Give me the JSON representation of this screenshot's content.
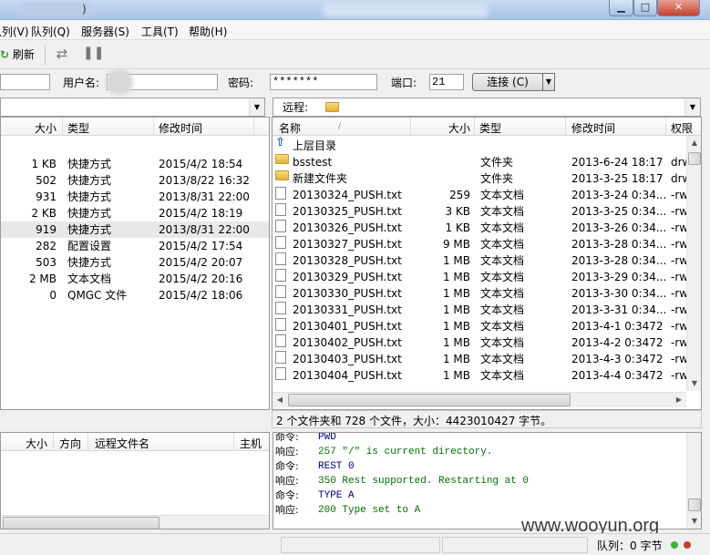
{
  "title_fragment": ")",
  "menu": [
    "队列(V)",
    "队列(Q)",
    "服务器(S)",
    "工具(T)",
    "帮助(H)"
  ],
  "toolbar": {
    "refresh_label": "刷新"
  },
  "quick": {
    "user_label": "用户名:",
    "pass_label": "密码:",
    "pass_value": "*******",
    "port_label": "端口:",
    "port_value": "21",
    "connect_label": "连接 (C)"
  },
  "local": {
    "columns": [
      "大小",
      "类型",
      "修改时间"
    ],
    "rows": [
      {
        "size": "1 KB",
        "type": "快捷方式",
        "mtime": "2015/4/2 18:54"
      },
      {
        "size": "502",
        "type": "快捷方式",
        "mtime": "2013/8/22 16:32"
      },
      {
        "size": "931",
        "type": "快捷方式",
        "mtime": "2013/8/31 22:00"
      },
      {
        "size": "2 KB",
        "type": "快捷方式",
        "mtime": "2015/4/2 18:19"
      },
      {
        "size": "919",
        "type": "快捷方式",
        "mtime": "2013/8/31 22:00"
      },
      {
        "size": "282",
        "type": "配置设置",
        "mtime": "2015/4/2 17:54"
      },
      {
        "size": "503",
        "type": "快捷方式",
        "mtime": "2015/4/2 20:07"
      },
      {
        "size": "2 MB",
        "type": "文本文档",
        "mtime": "2015/4/2 20:16"
      },
      {
        "size": "0",
        "type": "QMGC 文件",
        "mtime": "2015/4/2 18:06"
      }
    ]
  },
  "remote": {
    "path_label": "远程:",
    "columns": [
      "名称",
      "大小",
      "类型",
      "修改时间",
      "权限"
    ],
    "sort_indicator": "/",
    "parent_dir": "上层目录",
    "rows": [
      {
        "name": "bsstest",
        "size": "",
        "type": "文件夹",
        "mtime": "2013-6-24 18:17",
        "perm": "drw",
        "kind": "folder"
      },
      {
        "name": "新建文件夹",
        "size": "",
        "type": "文件夹",
        "mtime": "2013-3-25 18:17",
        "perm": "drw",
        "kind": "folder"
      },
      {
        "name": "20130324_PUSH.txt",
        "size": "259",
        "type": "文本文档",
        "mtime": "2013-3-24 0:34...",
        "perm": "-rw",
        "kind": "file"
      },
      {
        "name": "20130325_PUSH.txt",
        "size": "3 KB",
        "type": "文本文档",
        "mtime": "2013-3-25 0:34...",
        "perm": "-rw",
        "kind": "file"
      },
      {
        "name": "20130326_PUSH.txt",
        "size": "1 KB",
        "type": "文本文档",
        "mtime": "2013-3-26 0:34...",
        "perm": "-rw",
        "kind": "file"
      },
      {
        "name": "20130327_PUSH.txt",
        "size": "9 MB",
        "type": "文本文档",
        "mtime": "2013-3-28 0:34...",
        "perm": "-rw",
        "kind": "file"
      },
      {
        "name": "20130328_PUSH.txt",
        "size": "1 MB",
        "type": "文本文档",
        "mtime": "2013-3-28 0:34...",
        "perm": "-rw",
        "kind": "file"
      },
      {
        "name": "20130329_PUSH.txt",
        "size": "1 MB",
        "type": "文本文档",
        "mtime": "2013-3-29 0:34...",
        "perm": "-rw",
        "kind": "file"
      },
      {
        "name": "20130330_PUSH.txt",
        "size": "1 MB",
        "type": "文本文档",
        "mtime": "2013-3-30 0:34...",
        "perm": "-rw",
        "kind": "file"
      },
      {
        "name": "20130331_PUSH.txt",
        "size": "1 MB",
        "type": "文本文档",
        "mtime": "2013-3-31 0:34...",
        "perm": "-rw",
        "kind": "file"
      },
      {
        "name": "20130401_PUSH.txt",
        "size": "1 MB",
        "type": "文本文档",
        "mtime": "2013-4-1 0:3472",
        "perm": "-rw",
        "kind": "file"
      },
      {
        "name": "20130402_PUSH.txt",
        "size": "1 MB",
        "type": "文本文档",
        "mtime": "2013-4-2 0:3472",
        "perm": "-rw",
        "kind": "file"
      },
      {
        "name": "20130403_PUSH.txt",
        "size": "1 MB",
        "type": "文本文档",
        "mtime": "2013-4-3 0:3472",
        "perm": "-rw",
        "kind": "file"
      },
      {
        "name": "20130404_PUSH.txt",
        "size": "1 MB",
        "type": "文本文档",
        "mtime": "2013-4-4 0:3472",
        "perm": "-rw",
        "kind": "file"
      }
    ],
    "status": "2 个文件夹和 728 个文件，大小：4423010427 字节。"
  },
  "queue": {
    "columns": [
      "大小",
      "方向",
      "远程文件名",
      "主机"
    ]
  },
  "log": [
    {
      "label": "命令:",
      "text": "PWD",
      "kind": "cmd"
    },
    {
      "label": "响应:",
      "text": "257 \"/\" is current directory.",
      "kind": "resp"
    },
    {
      "label": "命令:",
      "text": "REST 0",
      "kind": "cmd"
    },
    {
      "label": "响应:",
      "text": "350 Rest supported. Restarting at 0",
      "kind": "resp"
    },
    {
      "label": "命令:",
      "text": "TYPE A",
      "kind": "cmd"
    },
    {
      "label": "响应:",
      "text": "200 Type set to A",
      "kind": "resp"
    }
  ],
  "statusbar": {
    "queue_text": "队列：0 字节"
  },
  "watermark": "www.wooyun.org"
}
